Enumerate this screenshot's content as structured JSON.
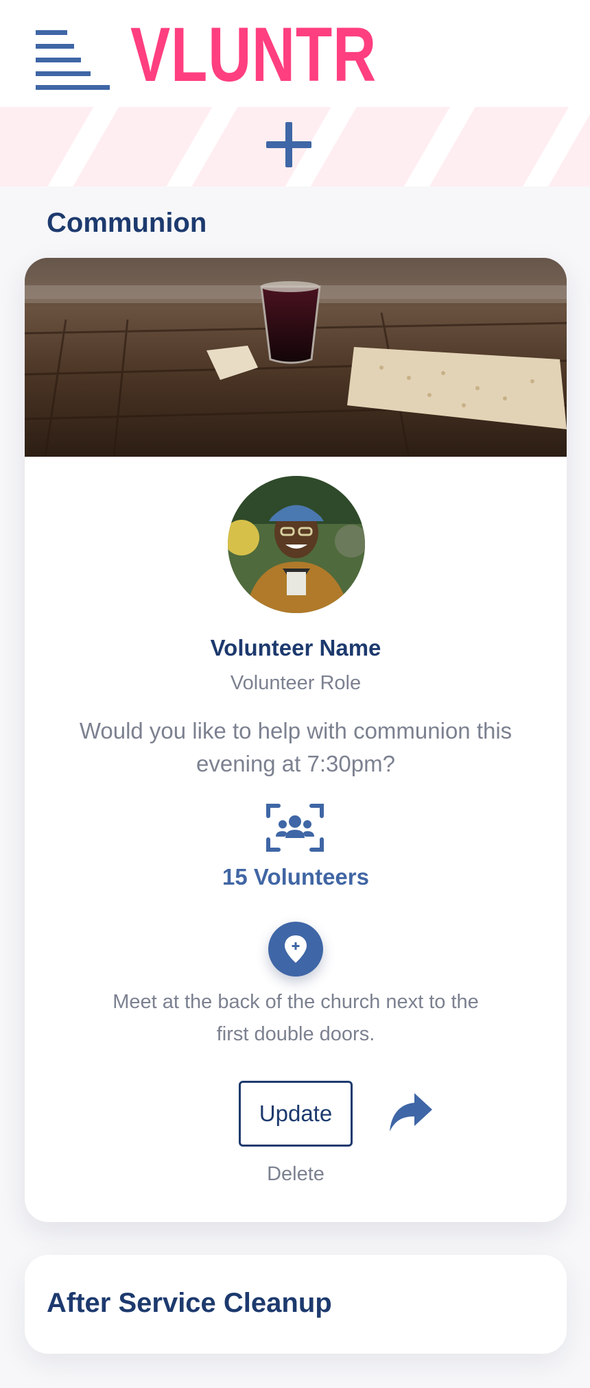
{
  "app": {
    "brand": "VLUNTR",
    "brand_color": "#ff3f7f",
    "menu_icon": "menu-icon"
  },
  "add_banner": {
    "icon": "plus-icon"
  },
  "section": {
    "title": "Communion"
  },
  "opportunity": {
    "hero_image": "communion-cup-and-bread",
    "volunteer_name": "Volunteer Name",
    "volunteer_role": "Volunteer Role",
    "question": "Would you like to help with communion this evening at 7:30pm?",
    "volunteers_icon": "group-users-icon",
    "volunteers_count": "15 Volunteers",
    "location_icon": "location-pin-icon",
    "meeting_point": "Meet at the back of the church next to the first double doors.",
    "update_label": "Update",
    "share_icon": "share-arrow-icon",
    "delete_label": "Delete"
  },
  "next_card": {
    "title": "After Service Cleanup"
  },
  "colors": {
    "primary_navy": "#1d3a6e",
    "accent_blue": "#3f66a6",
    "muted_text": "#7c8190",
    "banner_pink": "#ffeef1"
  }
}
